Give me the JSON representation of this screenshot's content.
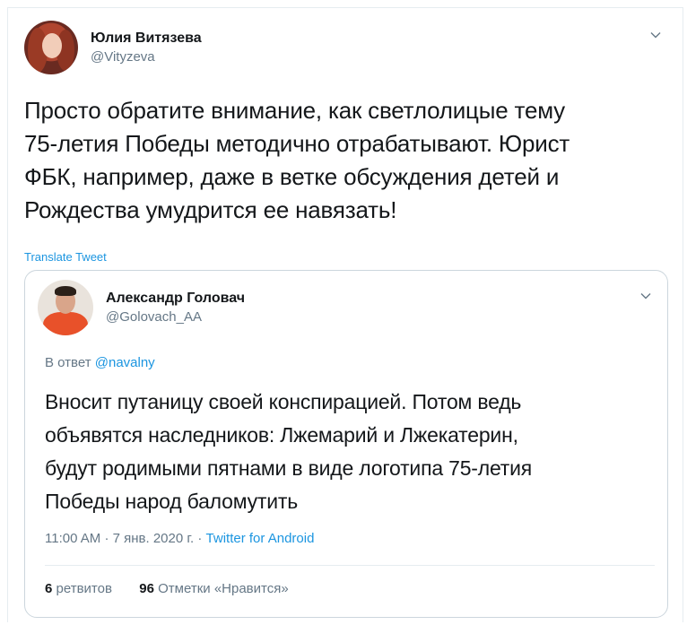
{
  "tweet": {
    "display_name": "Юлия Витязева",
    "handle": "@Vityzeva",
    "text_lines": [
      "Просто обратите внимание, как светлолицые тему",
      "75-летия Победы методично отрабатывают. Юрист",
      "ФБК, например, даже в ветке обсуждения детей и",
      "Рождества умудрится ее навязать!"
    ],
    "translate_label": "Translate Tweet",
    "menu_icon": "chevron-down-icon"
  },
  "quoted_tweet": {
    "display_name": "Александр Головач",
    "handle": "@Golovach_AA",
    "reply_prefix": "В ответ",
    "reply_handle": "@navalny",
    "text_lines": [
      "Вносит путаницу своей конспирацией. Потом ведь",
      "объявятся наследников: Лжемарий и Лжекатерин,",
      "будут родимыми пятнами в виде логотипа 75-летия",
      "Победы народ баломутить"
    ],
    "time": "11:00 AM",
    "date": "7 янв. 2020 г.",
    "separator": "·",
    "source": "Twitter for Android",
    "retweets_count": "6",
    "retweets_label": "ретвитов",
    "likes_count": "96",
    "likes_label": "Отметки «Нравится»",
    "menu_icon": "chevron-down-icon"
  },
  "colors": {
    "text": "#14171a",
    "secondary": "#657786",
    "link": "#1b95e0",
    "border": "#ccd6dd"
  }
}
